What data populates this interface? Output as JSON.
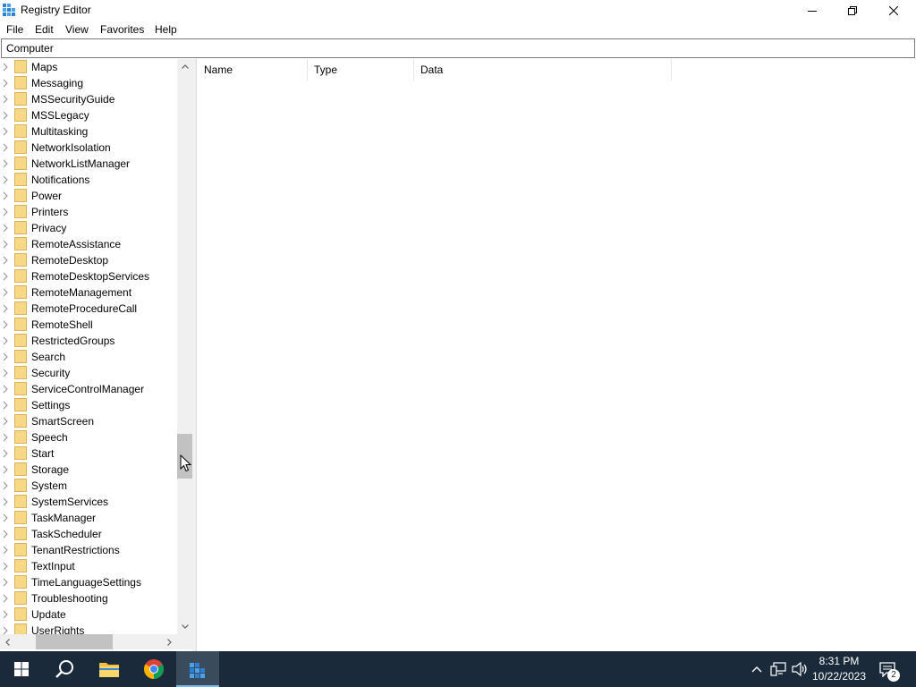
{
  "window": {
    "title": "Registry Editor",
    "controls": {
      "minimize": "minimize",
      "maximize": "restore",
      "close": "close"
    }
  },
  "menu": [
    "File",
    "Edit",
    "View",
    "Favorites",
    "Help"
  ],
  "address": {
    "value": "Computer"
  },
  "tree": {
    "items": [
      "Maps",
      "Messaging",
      "MSSecurityGuide",
      "MSSLegacy",
      "Multitasking",
      "NetworkIsolation",
      "NetworkListManager",
      "Notifications",
      "Power",
      "Printers",
      "Privacy",
      "RemoteAssistance",
      "RemoteDesktop",
      "RemoteDesktopServices",
      "RemoteManagement",
      "RemoteProcedureCall",
      "RemoteShell",
      "RestrictedGroups",
      "Search",
      "Security",
      "ServiceControlManager",
      "Settings",
      "SmartScreen",
      "Speech",
      "Start",
      "Storage",
      "System",
      "SystemServices",
      "TaskManager",
      "TaskScheduler",
      "TenantRestrictions",
      "TextInput",
      "TimeLanguageSettings",
      "Troubleshooting",
      "Update",
      "UserRights"
    ],
    "icons": {
      "expand": "chevron-right-icon",
      "folder": "folder-icon"
    },
    "vertical_scroll_position": 0.72,
    "horizontal_scroll_position": 0.3
  },
  "list": {
    "columns": [
      "Name",
      "Type",
      "Data"
    ],
    "rows": []
  },
  "taskbar": {
    "apps": [
      {
        "name": "start",
        "icon": "windows-start-icon"
      },
      {
        "name": "search",
        "icon": "search-icon"
      },
      {
        "name": "file-explorer",
        "icon": "folder-icon"
      },
      {
        "name": "chrome",
        "icon": "chrome-icon"
      },
      {
        "name": "registry-editor",
        "icon": "regedit-icon",
        "active": true
      }
    ],
    "tray": {
      "icons": [
        "chevron-up-icon",
        "network-icon",
        "volume-icon"
      ],
      "time": "8:31 PM",
      "date": "10/22/2023",
      "notifications": "2"
    }
  },
  "colors": {
    "taskbar": "#1a2a3a",
    "folder": "#f4d57a",
    "accent": "#76b9ed"
  }
}
